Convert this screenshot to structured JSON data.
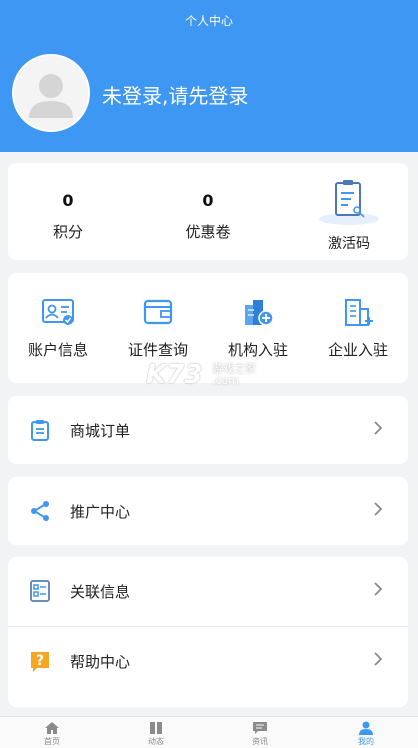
{
  "header": {
    "title": "个人中心",
    "login_prompt": "未登录,请先登录"
  },
  "stats": {
    "points_value": "0",
    "points_label": "积分",
    "coupons_value": "0",
    "coupons_label": "优惠卷",
    "activation_label": "激活码"
  },
  "grid": {
    "items": [
      {
        "label": "账户信息",
        "icon": "account-card-icon"
      },
      {
        "label": "证件查询",
        "icon": "wallet-icon"
      },
      {
        "label": "机构入驻",
        "icon": "building-add-icon"
      },
      {
        "label": "企业入驻",
        "icon": "enterprise-add-icon"
      }
    ]
  },
  "menu": {
    "orders_label": "商城订单",
    "promo_label": "推广中心",
    "related_label": "关联信息",
    "help_label": "帮助中心"
  },
  "watermark": {
    "main": "K73",
    "sub1": "游戏之家",
    "sub2": ".com"
  },
  "tabbar": {
    "items": [
      {
        "label": "首页",
        "icon": "home-icon"
      },
      {
        "label": "动态",
        "icon": "dynamics-icon"
      },
      {
        "label": "资讯",
        "icon": "news-icon"
      },
      {
        "label": "我的",
        "icon": "profile-icon"
      }
    ],
    "active": "我的"
  },
  "colors": {
    "primary": "#3d97f3",
    "help_icon": "#f5a623",
    "background": "#f2f3f5"
  }
}
